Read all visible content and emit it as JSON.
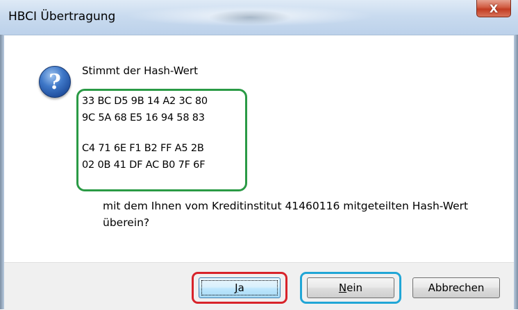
{
  "window": {
    "title": "HBCI Übertragung",
    "close_glyph": "X"
  },
  "dialog": {
    "icon": "question-icon",
    "question": "Stimmt der Hash-Wert",
    "hash_lines": [
      "33 BC D5 9B 14 A2 3C 80",
      "9C 5A 68 E5 16 94 58 83",
      "C4 71 6E F1 B2 FF A5 2B",
      "02 0B 41 DF AC B0 7F 6F"
    ],
    "message_line1": "mit dem Ihnen vom Kreditinstitut 41460116 mitgeteilten Hash-Wert",
    "message_line2": "überein?"
  },
  "buttons": {
    "ja_mnemonic": "J",
    "ja_rest": "a",
    "nein_mnemonic": "N",
    "nein_rest": "ein",
    "abbrechen": "Abbrechen"
  },
  "colors": {
    "hash_highlight": "#2a9a45",
    "ja_highlight": "#d8232a",
    "nein_highlight": "#21a6d6"
  }
}
